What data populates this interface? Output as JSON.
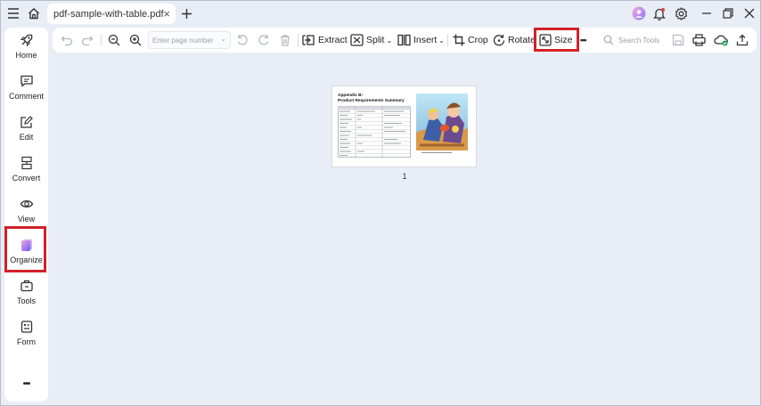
{
  "titlebar": {
    "tab_title": "pdf-sample-with-table.pdf",
    "tab_close": "×",
    "new_tab": "+"
  },
  "sidebar": {
    "items": [
      {
        "label": "Home",
        "icon": "rocket-icon"
      },
      {
        "label": "Comment",
        "icon": "comment-icon"
      },
      {
        "label": "Edit",
        "icon": "edit-icon"
      },
      {
        "label": "Convert",
        "icon": "convert-icon"
      },
      {
        "label": "View",
        "icon": "eye-icon"
      },
      {
        "label": "Organize",
        "icon": "organize-icon",
        "active": true
      },
      {
        "label": "Tools",
        "icon": "toolbox-icon"
      },
      {
        "label": "Form",
        "icon": "form-icon"
      }
    ],
    "more": "•••"
  },
  "toolbar": {
    "page_placeholder": "Enter page number",
    "extract_label": "Extract",
    "split_label": "Split",
    "insert_label": "Insert",
    "crop_label": "Crop",
    "rotate_label": "Rotate",
    "size_label": "Size",
    "more_label": "•••",
    "search_placeholder": "Search Tools"
  },
  "document": {
    "heading_line1": "Appendix B:",
    "heading_line2": "Product Requirements Summary",
    "page_number": "1"
  },
  "colors": {
    "highlight": "#d3202a",
    "accent": "#6b5cf6",
    "background": "#e9edf5"
  }
}
